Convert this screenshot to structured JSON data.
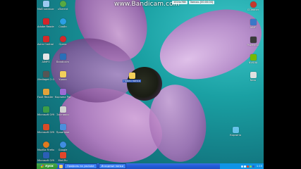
{
  "watermark": "www.Bandicam.com",
  "topbar": {
    "resolution": "1024x768",
    "record_time": "Запись [00:00:00]"
  },
  "desktop": {
    "left_icons": [
      {
        "label": "Мой компьютер",
        "color": "#9ccaf0"
      },
      {
        "label": "uTorrent",
        "color": "#57a941"
      },
      {
        "label": "Adobe Reader",
        "color": "#d3252a"
      },
      {
        "label": "Скайп",
        "color": "#2a9fe5"
      },
      {
        "label": "Avira Control Center",
        "color": "#d42a2a"
      },
      {
        "label": "Opera",
        "color": "#d22a2a"
      },
      {
        "label": "AIMP3",
        "color": "#e6e6e6"
      },
      {
        "label": "Bandicam",
        "color": "#2a6fb8"
      },
      {
        "label": "Mediaget 2.0",
        "color": "#555555"
      },
      {
        "label": "Уроки",
        "color": "#f2cf5a"
      },
      {
        "label": "Foxit Reader 6.1",
        "color": "#e3a23a"
      },
      {
        "label": "Корзина Pro",
        "color": "#9c6bd4"
      },
      {
        "label": "Microsoft Office Ex..",
        "color": "#3c9e48"
      },
      {
        "label": "Заставки",
        "color": "#d2d2d2"
      },
      {
        "label": "Microsoft Office Ex..",
        "color": "#d84b27"
      },
      {
        "label": "Проигрыв",
        "color": "#4c8fdc"
      },
      {
        "label": "Mozilla Firefox",
        "color": "#e07a1f"
      },
      {
        "label": "Google",
        "color": "#3f8de0"
      },
      {
        "label": "Microsoft Office Wo..",
        "color": "#2b5fb6"
      },
      {
        "label": "Mail.Ru",
        "color": "#e2462a"
      }
    ],
    "right_icons": [
      {
        "label": "CCleaner",
        "color": "#c4372d"
      },
      {
        "label": "AIMP",
        "color": "#3a78c8"
      },
      {
        "label": "PowerISO",
        "color": "#3a3a3a"
      },
      {
        "label": "NVIDIA",
        "color": "#76b900"
      },
      {
        "label": "Nero",
        "color": "#e0e0e0"
      },
      {
        "label": "Корзина",
        "color": "#66c3e9"
      }
    ],
    "center_folder": {
      "label": "Новая папка",
      "color": "#f2cf5a"
    }
  },
  "taskbar": {
    "start_label": "пуск",
    "buttons": [
      "Профиль на youtube",
      "Исходные папки"
    ],
    "clock": "1:15"
  },
  "colors": {
    "taskbar": "#245edb",
    "start": "#3a9a3a",
    "tray": "#0f94e6"
  }
}
